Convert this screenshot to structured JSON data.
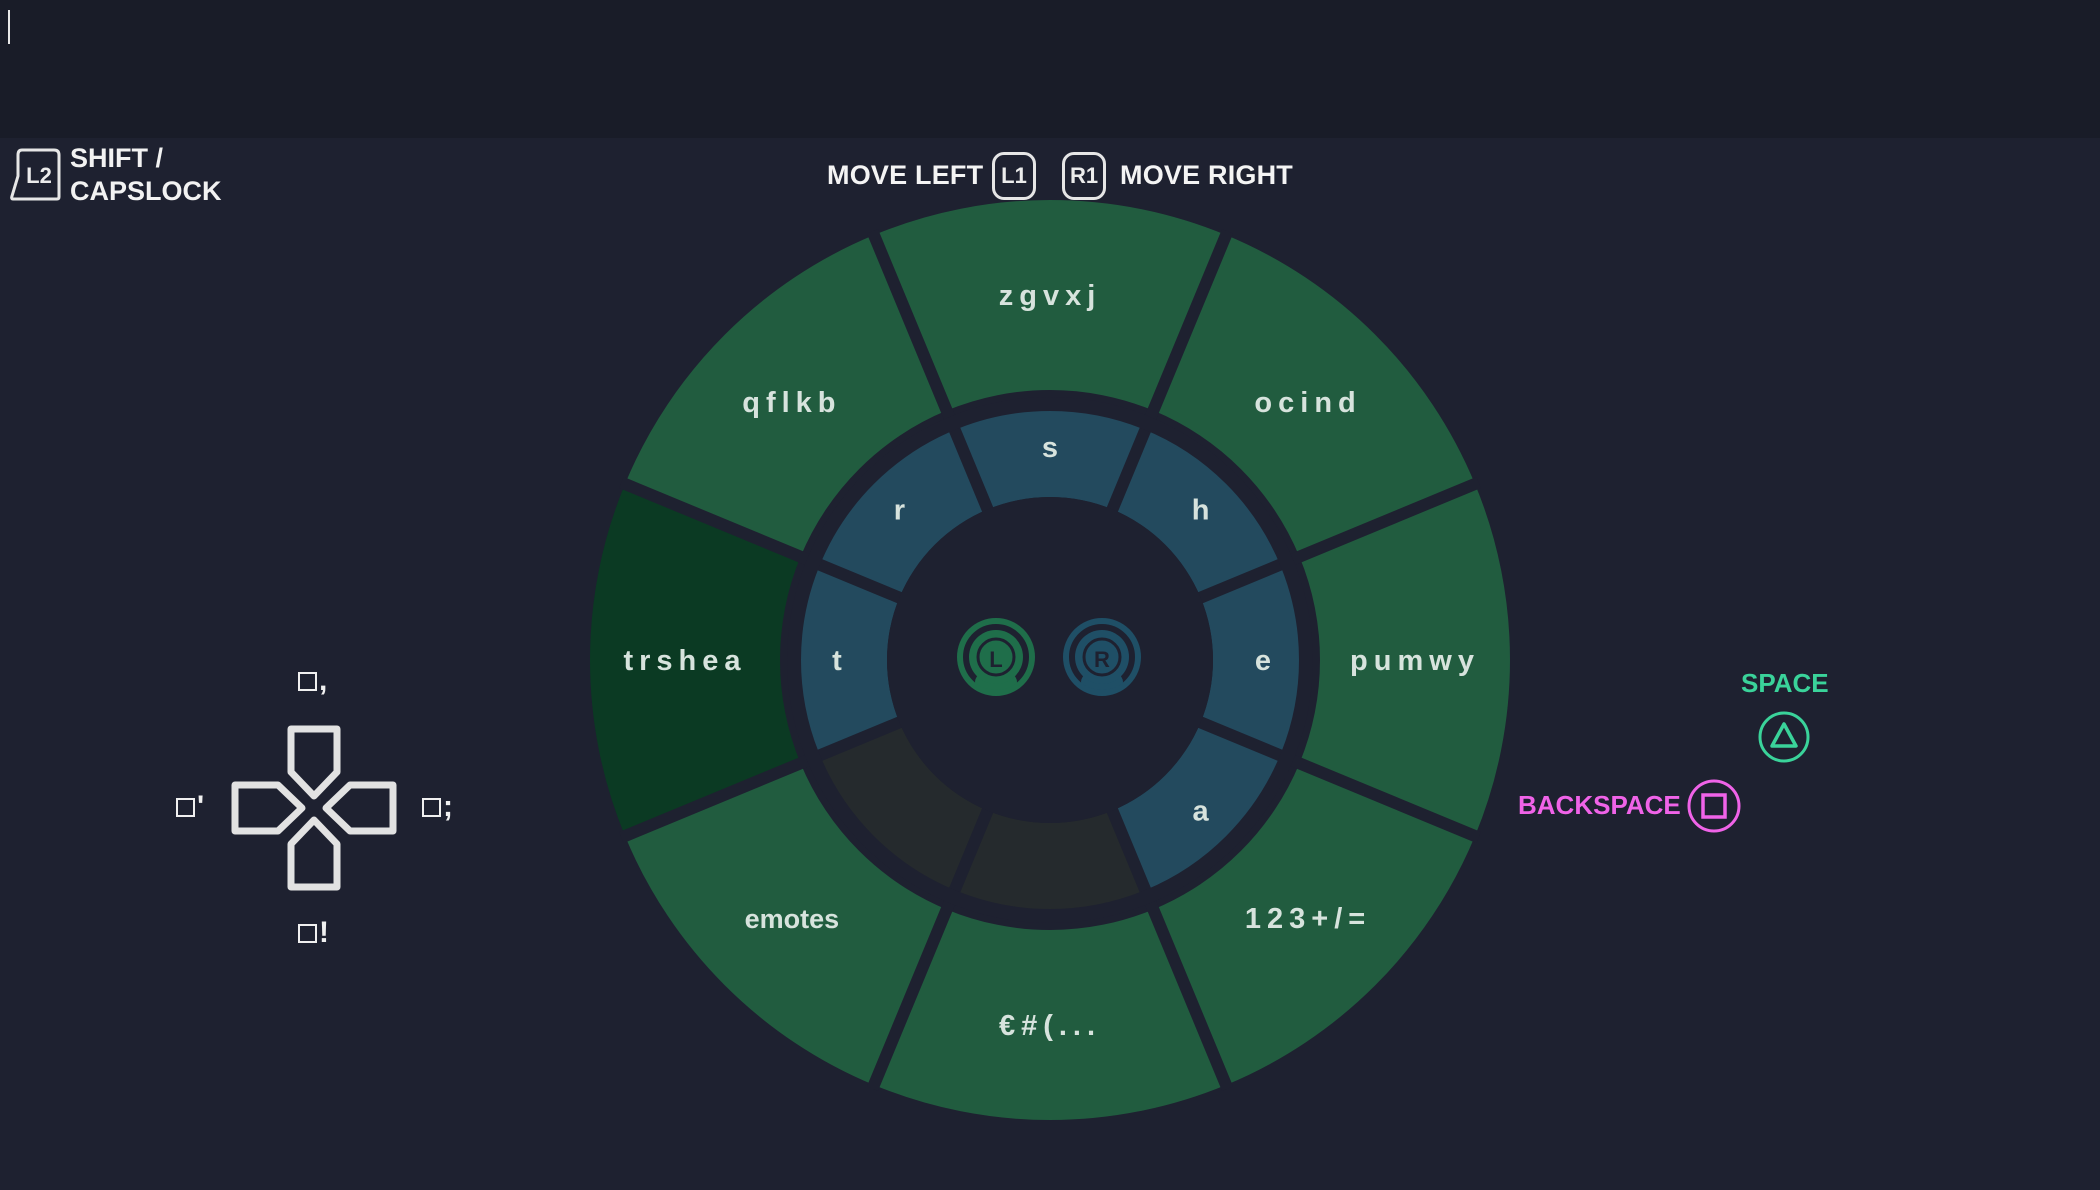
{
  "input": {
    "value": ""
  },
  "shift": {
    "button": "L2",
    "label_line1": "SHIFT /",
    "label_line2": "CAPSLOCK"
  },
  "move": {
    "left_label": "MOVE LEFT",
    "left_button": "L1",
    "right_button": "R1",
    "right_label": "MOVE RIGHT"
  },
  "wheel": {
    "outer_segments": [
      "zgvxj",
      "ocind",
      "pumwy",
      "123+/=",
      "€#(...",
      "emotes",
      "trshea",
      "qflkb"
    ],
    "selected_segment": "trshea",
    "inner_keys": [
      "s",
      "h",
      "e",
      "a",
      "",
      "",
      "t",
      "r"
    ],
    "sticks": {
      "left": "L",
      "right": "R"
    },
    "colors": {
      "outer": "#215c3f",
      "outer_selected": "#0b3a23",
      "inner": "#234a5e",
      "inner_empty": "#252a2d",
      "gap": "#1e2130",
      "left_stick": "#1f6e4a",
      "right_stick": "#1f4f66"
    }
  },
  "dpad": {
    "up_hint": ",",
    "left_hint": "'",
    "right_hint": ";",
    "down_hint": "!"
  },
  "actions": {
    "space_label": "SPACE",
    "space_button": "triangle-icon",
    "space_color": "#3ad39a",
    "backspace_label": "BACKSPACE",
    "backspace_button": "square-icon",
    "backspace_color": "#f063e8"
  }
}
